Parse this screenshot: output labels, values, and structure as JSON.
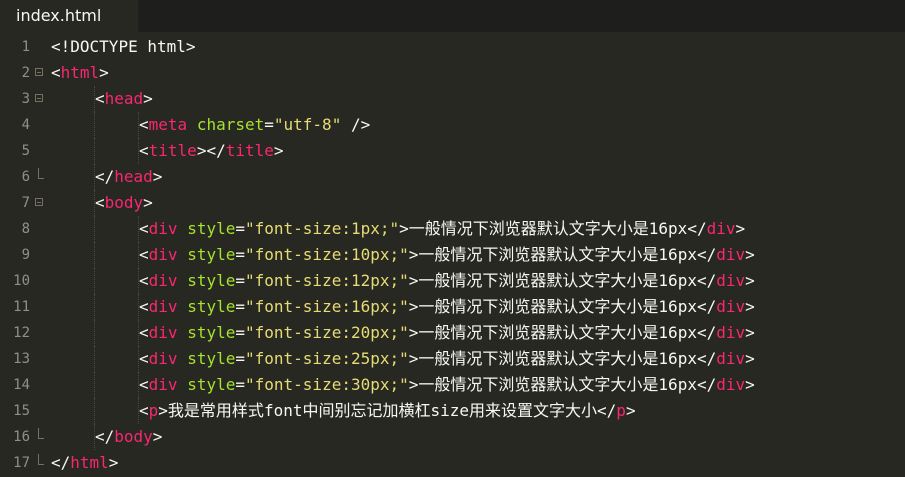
{
  "tab": {
    "title": "index.html"
  },
  "lines": [
    {
      "num": "1",
      "fold": "",
      "indent": 0,
      "tokens": [
        [
          "w",
          "<"
        ],
        [
          "w",
          "!DOCTYPE html"
        ],
        [
          "w",
          ">"
        ]
      ]
    },
    {
      "num": "2",
      "fold": "open",
      "indent": 0,
      "tokens": [
        [
          "w",
          "<"
        ],
        [
          "t",
          "html"
        ],
        [
          "w",
          ">"
        ]
      ]
    },
    {
      "num": "3",
      "fold": "open",
      "indent": 1,
      "tokens": [
        [
          "w",
          "<"
        ],
        [
          "t",
          "head"
        ],
        [
          "w",
          ">"
        ]
      ]
    },
    {
      "num": "4",
      "fold": "",
      "indent": 2,
      "tokens": [
        [
          "w",
          "<"
        ],
        [
          "t",
          "meta"
        ],
        [
          "w",
          " "
        ],
        [
          "a",
          "charset"
        ],
        [
          "w",
          "="
        ],
        [
          "s",
          "\"utf-8\""
        ],
        [
          "w",
          " />"
        ]
      ]
    },
    {
      "num": "5",
      "fold": "",
      "indent": 2,
      "tokens": [
        [
          "w",
          "<"
        ],
        [
          "t",
          "title"
        ],
        [
          "w",
          "></"
        ],
        [
          "t",
          "title"
        ],
        [
          "w",
          ">"
        ]
      ]
    },
    {
      "num": "6",
      "fold": "end",
      "indent": 1,
      "tokens": [
        [
          "w",
          "</"
        ],
        [
          "t",
          "head"
        ],
        [
          "w",
          ">"
        ]
      ]
    },
    {
      "num": "7",
      "fold": "open",
      "indent": 1,
      "tokens": [
        [
          "w",
          "<"
        ],
        [
          "t",
          "body"
        ],
        [
          "w",
          ">"
        ]
      ]
    },
    {
      "num": "8",
      "fold": "",
      "indent": 2,
      "tokens": [
        [
          "w",
          "<"
        ],
        [
          "t",
          "div"
        ],
        [
          "w",
          " "
        ],
        [
          "a",
          "style"
        ],
        [
          "w",
          "="
        ],
        [
          "s",
          "\"font-size:1px;\""
        ],
        [
          "w",
          ">"
        ],
        [
          "z",
          "一般情况下浏览器默认文字大小是"
        ],
        [
          "w",
          "16px</"
        ],
        [
          "t",
          "div"
        ],
        [
          "w",
          ">"
        ]
      ]
    },
    {
      "num": "9",
      "fold": "",
      "indent": 2,
      "tokens": [
        [
          "w",
          "<"
        ],
        [
          "t",
          "div"
        ],
        [
          "w",
          " "
        ],
        [
          "a",
          "style"
        ],
        [
          "w",
          "="
        ],
        [
          "s",
          "\"font-size:10px;\""
        ],
        [
          "w",
          ">"
        ],
        [
          "z",
          "一般情况下浏览器默认文字大小是"
        ],
        [
          "w",
          "16px</"
        ],
        [
          "t",
          "div"
        ],
        [
          "w",
          ">"
        ]
      ]
    },
    {
      "num": "10",
      "fold": "",
      "indent": 2,
      "tokens": [
        [
          "w",
          "<"
        ],
        [
          "t",
          "div"
        ],
        [
          "w",
          " "
        ],
        [
          "a",
          "style"
        ],
        [
          "w",
          "="
        ],
        [
          "s",
          "\"font-size:12px;\""
        ],
        [
          "w",
          ">"
        ],
        [
          "z",
          "一般情况下浏览器默认文字大小是"
        ],
        [
          "w",
          "16px</"
        ],
        [
          "t",
          "div"
        ],
        [
          "w",
          ">"
        ]
      ]
    },
    {
      "num": "11",
      "fold": "",
      "indent": 2,
      "tokens": [
        [
          "w",
          "<"
        ],
        [
          "t",
          "div"
        ],
        [
          "w",
          " "
        ],
        [
          "a",
          "style"
        ],
        [
          "w",
          "="
        ],
        [
          "s",
          "\"font-size:16px;\""
        ],
        [
          "w",
          ">"
        ],
        [
          "z",
          "一般情况下浏览器默认文字大小是"
        ],
        [
          "w",
          "16px</"
        ],
        [
          "t",
          "div"
        ],
        [
          "w",
          ">"
        ]
      ]
    },
    {
      "num": "12",
      "fold": "",
      "indent": 2,
      "tokens": [
        [
          "w",
          "<"
        ],
        [
          "t",
          "div"
        ],
        [
          "w",
          " "
        ],
        [
          "a",
          "style"
        ],
        [
          "w",
          "="
        ],
        [
          "s",
          "\"font-size:20px;\""
        ],
        [
          "w",
          ">"
        ],
        [
          "z",
          "一般情况下浏览器默认文字大小是"
        ],
        [
          "w",
          "16px</"
        ],
        [
          "t",
          "div"
        ],
        [
          "w",
          ">"
        ]
      ]
    },
    {
      "num": "13",
      "fold": "",
      "indent": 2,
      "tokens": [
        [
          "w",
          "<"
        ],
        [
          "t",
          "div"
        ],
        [
          "w",
          " "
        ],
        [
          "a",
          "style"
        ],
        [
          "w",
          "="
        ],
        [
          "s",
          "\"font-size:25px;\""
        ],
        [
          "w",
          ">"
        ],
        [
          "z",
          "一般情况下浏览器默认文字大小是"
        ],
        [
          "w",
          "16px</"
        ],
        [
          "t",
          "div"
        ],
        [
          "w",
          ">"
        ]
      ]
    },
    {
      "num": "14",
      "fold": "",
      "indent": 2,
      "tokens": [
        [
          "w",
          "<"
        ],
        [
          "t",
          "div"
        ],
        [
          "w",
          " "
        ],
        [
          "a",
          "style"
        ],
        [
          "w",
          "="
        ],
        [
          "s",
          "\"font-size:30px;\""
        ],
        [
          "w",
          ">"
        ],
        [
          "z",
          "一般情况下浏览器默认文字大小是"
        ],
        [
          "w",
          "16px</"
        ],
        [
          "t",
          "div"
        ],
        [
          "w",
          ">"
        ]
      ]
    },
    {
      "num": "15",
      "fold": "",
      "indent": 2,
      "tokens": [
        [
          "w",
          "<"
        ],
        [
          "t",
          "p"
        ],
        [
          "w",
          ">"
        ],
        [
          "z",
          "我是常用样式"
        ],
        [
          "w",
          "font"
        ],
        [
          "z",
          "中间别忘记加横杠"
        ],
        [
          "w",
          "size"
        ],
        [
          "z",
          "用来设置文字大小"
        ],
        [
          "w",
          "</"
        ],
        [
          "t",
          "p"
        ],
        [
          "w",
          ">"
        ]
      ]
    },
    {
      "num": "16",
      "fold": "end",
      "indent": 1,
      "tokens": [
        [
          "w",
          "</"
        ],
        [
          "t",
          "body"
        ],
        [
          "w",
          ">"
        ]
      ]
    },
    {
      "num": "17",
      "fold": "end",
      "indent": 0,
      "tokens": [
        [
          "w",
          "</"
        ],
        [
          "t",
          "html"
        ],
        [
          "w",
          ">"
        ]
      ]
    }
  ],
  "colors": {
    "background": "#272822",
    "tag": "#f92672",
    "attribute": "#a6e22e",
    "string": "#e6db74",
    "text": "#f8f8f2",
    "gutter": "#90908a"
  }
}
